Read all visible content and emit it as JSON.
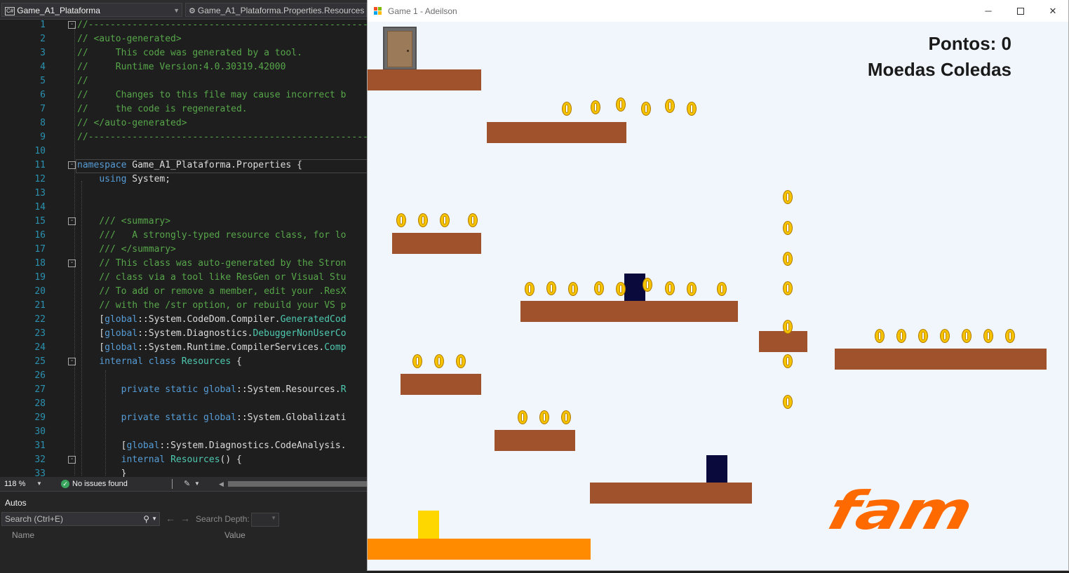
{
  "ide": {
    "nav_left": "Game_A1_Plataforma",
    "nav_right": "Game_A1_Plataforma.Properties.Resources",
    "lines": [
      {
        "n": "1",
        "fold": "-",
        "parts": [
          {
            "t": "//-----------------------------------------------------",
            "c": "c-green"
          }
        ]
      },
      {
        "n": "2",
        "fold": "",
        "parts": [
          {
            "t": "// <auto-generated>",
            "c": "c-green"
          }
        ]
      },
      {
        "n": "3",
        "fold": "",
        "parts": [
          {
            "t": "//     This code was generated by a tool.",
            "c": "c-green"
          }
        ]
      },
      {
        "n": "4",
        "fold": "",
        "parts": [
          {
            "t": "//     Runtime Version:4.0.30319.42000",
            "c": "c-green"
          }
        ]
      },
      {
        "n": "5",
        "fold": "",
        "parts": [
          {
            "t": "//",
            "c": "c-green"
          }
        ]
      },
      {
        "n": "6",
        "fold": "",
        "parts": [
          {
            "t": "//     Changes to this file may cause incorrect b",
            "c": "c-green"
          }
        ]
      },
      {
        "n": "7",
        "fold": "",
        "parts": [
          {
            "t": "//     the code is regenerated.",
            "c": "c-green"
          }
        ]
      },
      {
        "n": "8",
        "fold": "",
        "parts": [
          {
            "t": "// </auto-generated>",
            "c": "c-green"
          }
        ]
      },
      {
        "n": "9",
        "fold": "",
        "parts": [
          {
            "t": "//-----------------------------------------------------",
            "c": "c-green"
          }
        ]
      },
      {
        "n": "10",
        "fold": "",
        "parts": []
      },
      {
        "n": "11",
        "fold": "-",
        "parts": [
          {
            "t": "namespace",
            "c": "c-blue"
          },
          {
            "t": " Game_A1_Plataforma.Properties {",
            "c": "c-plain"
          }
        ]
      },
      {
        "n": "12",
        "fold": "",
        "parts": [
          {
            "t": "    ",
            "c": "c-plain"
          },
          {
            "t": "using",
            "c": "c-blue"
          },
          {
            "t": " System;",
            "c": "c-plain"
          }
        ]
      },
      {
        "n": "13",
        "fold": "",
        "parts": []
      },
      {
        "n": "14",
        "fold": "",
        "parts": []
      },
      {
        "n": "15",
        "fold": "-",
        "parts": [
          {
            "t": "    /// <summary>",
            "c": "c-green"
          }
        ]
      },
      {
        "n": "16",
        "fold": "",
        "parts": [
          {
            "t": "    ///   A strongly-typed resource class, for lo",
            "c": "c-green"
          }
        ]
      },
      {
        "n": "17",
        "fold": "",
        "parts": [
          {
            "t": "    /// </summary>",
            "c": "c-green"
          }
        ]
      },
      {
        "n": "18",
        "fold": "-",
        "parts": [
          {
            "t": "    // This class was auto-generated by the Stron",
            "c": "c-green"
          }
        ]
      },
      {
        "n": "19",
        "fold": "",
        "parts": [
          {
            "t": "    // class via a tool like ResGen or Visual Stu",
            "c": "c-green"
          }
        ]
      },
      {
        "n": "20",
        "fold": "",
        "parts": [
          {
            "t": "    // To add or remove a member, edit your .ResX",
            "c": "c-green"
          }
        ]
      },
      {
        "n": "21",
        "fold": "",
        "parts": [
          {
            "t": "    // with the /str option, or rebuild your VS p",
            "c": "c-green"
          }
        ]
      },
      {
        "n": "22",
        "fold": "",
        "parts": [
          {
            "t": "    [",
            "c": "c-plain"
          },
          {
            "t": "global",
            "c": "c-blue"
          },
          {
            "t": "::System.CodeDom.Compiler.",
            "c": "c-plain"
          },
          {
            "t": "GeneratedCod",
            "c": "c-teal"
          }
        ]
      },
      {
        "n": "23",
        "fold": "",
        "parts": [
          {
            "t": "    [",
            "c": "c-plain"
          },
          {
            "t": "global",
            "c": "c-blue"
          },
          {
            "t": "::System.Diagnostics.",
            "c": "c-plain"
          },
          {
            "t": "DebuggerNonUserCo",
            "c": "c-teal"
          }
        ]
      },
      {
        "n": "24",
        "fold": "",
        "parts": [
          {
            "t": "    [",
            "c": "c-plain"
          },
          {
            "t": "global",
            "c": "c-blue"
          },
          {
            "t": "::System.Runtime.CompilerServices.",
            "c": "c-plain"
          },
          {
            "t": "Comp",
            "c": "c-teal"
          }
        ]
      },
      {
        "n": "25",
        "fold": "-",
        "parts": [
          {
            "t": "    ",
            "c": "c-plain"
          },
          {
            "t": "internal class",
            "c": "c-blue"
          },
          {
            "t": " ",
            "c": "c-plain"
          },
          {
            "t": "Resources",
            "c": "c-teal"
          },
          {
            "t": " {",
            "c": "c-plain"
          }
        ]
      },
      {
        "n": "26",
        "fold": "",
        "parts": []
      },
      {
        "n": "27",
        "fold": "",
        "parts": [
          {
            "t": "        ",
            "c": "c-plain"
          },
          {
            "t": "private static global",
            "c": "c-blue"
          },
          {
            "t": "::System.Resources.",
            "c": "c-plain"
          },
          {
            "t": "R",
            "c": "c-teal"
          }
        ]
      },
      {
        "n": "28",
        "fold": "",
        "parts": []
      },
      {
        "n": "29",
        "fold": "",
        "parts": [
          {
            "t": "        ",
            "c": "c-plain"
          },
          {
            "t": "private static global",
            "c": "c-blue"
          },
          {
            "t": "::System.Globalizati",
            "c": "c-plain"
          }
        ]
      },
      {
        "n": "30",
        "fold": "",
        "parts": []
      },
      {
        "n": "31",
        "fold": "",
        "parts": [
          {
            "t": "        [",
            "c": "c-plain"
          },
          {
            "t": "global",
            "c": "c-blue"
          },
          {
            "t": "::System.Diagnostics.CodeAnalysis.",
            "c": "c-plain"
          }
        ]
      },
      {
        "n": "32",
        "fold": "-",
        "parts": [
          {
            "t": "        ",
            "c": "c-plain"
          },
          {
            "t": "internal",
            "c": "c-blue"
          },
          {
            "t": " ",
            "c": "c-plain"
          },
          {
            "t": "Resources",
            "c": "c-teal"
          },
          {
            "t": "() {",
            "c": "c-plain"
          }
        ]
      },
      {
        "n": "33",
        "fold": "",
        "parts": [
          {
            "t": "        }",
            "c": "c-plain"
          }
        ]
      }
    ],
    "status": {
      "zoom": "118 %",
      "issues": "No issues found"
    },
    "autos": {
      "title": "Autos",
      "search_placeholder": "Search (Ctrl+E)",
      "search_depth_label": "Search Depth:",
      "col_name": "Name",
      "col_value": "Value"
    }
  },
  "game": {
    "window_title": "Game 1 - Adeilson",
    "hud_pontos": "Pontos: 0",
    "hud_moedas": "Moedas Coledas",
    "logo_text": "fam",
    "colors": {
      "background": "#f0f6fc",
      "platform": "#a0522d",
      "ground": "#ff8c00",
      "player": "#ffd700",
      "enemy": "#0a0a3c",
      "coin": "#f6c300",
      "logo": "#ff6a00"
    }
  }
}
